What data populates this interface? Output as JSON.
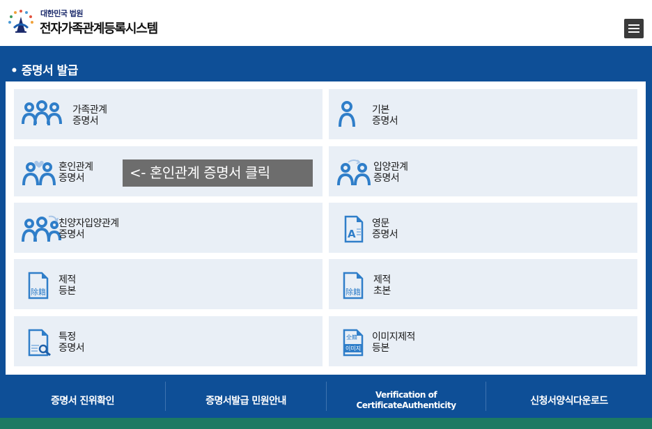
{
  "header": {
    "logo_subtitle": "대한민국 법원",
    "logo_title": "전자가족관계등록시스템"
  },
  "panel": {
    "title": "• 증명서 발급"
  },
  "tiles": [
    {
      "line1": "가족관계",
      "line2": "증명서",
      "icon": "family-icon"
    },
    {
      "line1": "기본",
      "line2": "증명서",
      "icon": "person-icon"
    },
    {
      "line1": "혼인관계",
      "line2": "증명서",
      "icon": "marriage-icon"
    },
    {
      "line1": "입양관계",
      "line2": "증명서",
      "icon": "adoption-icon"
    },
    {
      "line1": "친양자입양관계",
      "line2": "증명서",
      "icon": "full-adoption-icon"
    },
    {
      "line1": "영문",
      "line2": "증명서",
      "icon": "english-document-icon"
    },
    {
      "line1": "제적",
      "line2": "등본",
      "icon": "removed-register-icon"
    },
    {
      "line1": "제적",
      "line2": "초본",
      "icon": "removed-register-icon"
    },
    {
      "line1": "특정",
      "line2": "증명서",
      "icon": "search-document-icon"
    },
    {
      "line1": "이미지제적",
      "line2": "등본",
      "icon": "image-register-icon"
    }
  ],
  "annotation": "<- 혼인관계 증명서 클릭",
  "icon_text": {
    "removed": "除籍",
    "image_top": "全籍",
    "image_label": "이미지"
  },
  "footer": {
    "items": [
      "증명서 진위확인",
      "증명서발급 민원안내",
      "Verification of CertificateAuthenticity",
      "신청서양식다운로드"
    ]
  },
  "colors": {
    "panel_blue": "#0e4f97",
    "tile_bg": "#e9eff6",
    "icon_blue": "#2f7ec9",
    "bottom_green": "#1c7a63"
  }
}
